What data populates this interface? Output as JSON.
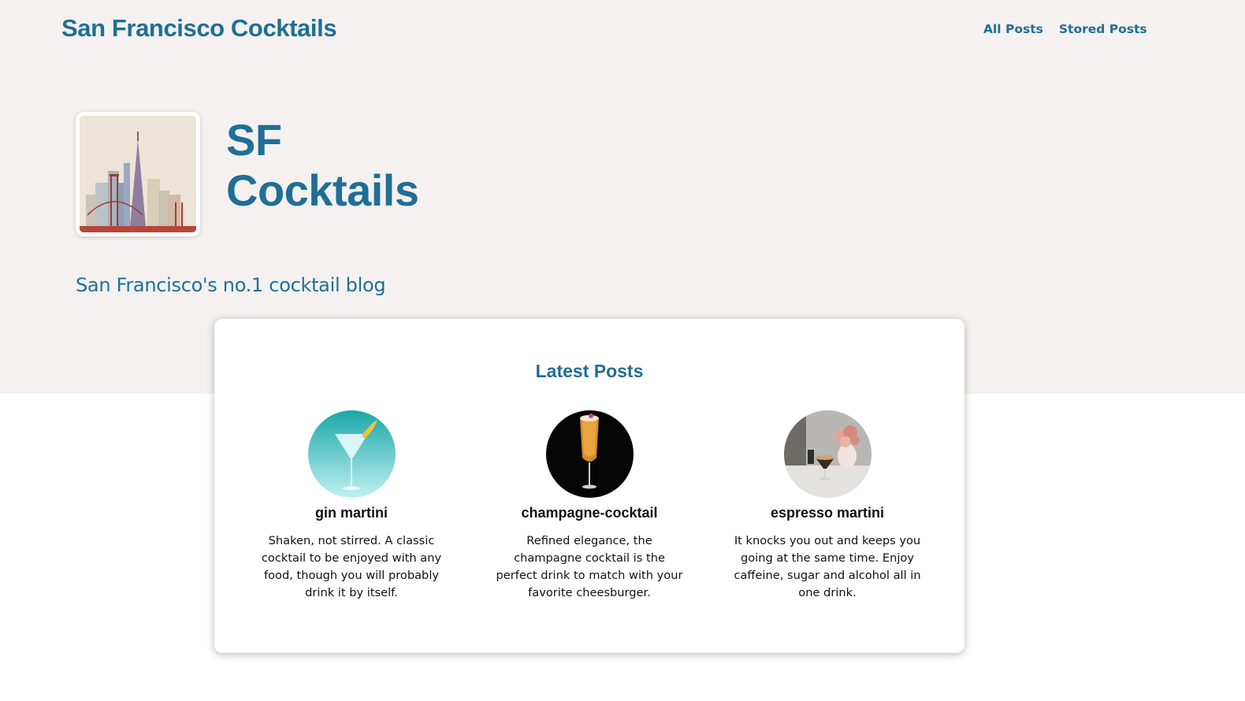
{
  "header": {
    "site_title": "San Francisco Cocktails",
    "nav": [
      {
        "label": "All Posts"
      },
      {
        "label": "Stored Posts"
      }
    ]
  },
  "hero": {
    "title_line1": "SF",
    "title_line2": "Cocktails",
    "tagline": "San Francisco's no.1 cocktail blog",
    "logo_icon": "san-francisco-skyline-illustration"
  },
  "latest": {
    "heading": "Latest Posts",
    "posts": [
      {
        "title": "gin martini",
        "description": "Shaken, not stirred. A classic cocktail to be enjoyed with any food, though you will probably drink it by itself.",
        "image": "martini-glass-photo"
      },
      {
        "title": "champagne-cocktail",
        "description": "Refined elegance, the champagne cocktail is the perfect drink to match with your favorite cheesburger.",
        "image": "champagne-flute-photo"
      },
      {
        "title": "espresso martini",
        "description": "It knocks you out and keeps you going at the same time. Enjoy caffeine, sugar and alcohol all in one drink.",
        "image": "espresso-martini-photo"
      }
    ]
  },
  "colors": {
    "accent": "#1f6f95",
    "hero_background": "#f4f1f0",
    "page_background": "#ffffff"
  }
}
